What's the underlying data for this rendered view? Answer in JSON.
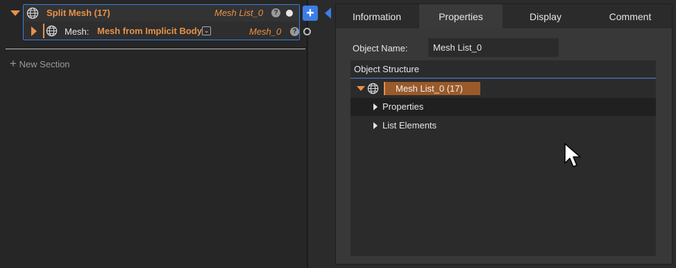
{
  "node": {
    "title": "Split Mesh (17)",
    "output_name": "Mesh List_0",
    "help": "?",
    "input_label": "Mesh:",
    "input_value": "Mesh from Implicit Body",
    "input_output_name": "Mesh_0",
    "dropdown_glyph": "⌄"
  },
  "sections": {
    "new_section_label": "New Section",
    "plus": "+"
  },
  "add_button": "+",
  "tabs": [
    "Information",
    "Properties",
    "Display",
    "Comment"
  ],
  "active_tab": "Properties",
  "object_name": {
    "label": "Object Name:",
    "value": "Mesh List_0"
  },
  "structure": {
    "header": "Object Structure",
    "root": "Mesh List_0 (17)",
    "children": [
      "Properties",
      "List Elements"
    ]
  },
  "colors": {
    "accent": "#3b7ee6",
    "orange": "#e8914a",
    "selection": "#9a5a2a"
  },
  "icons": [
    "mesh-globe-icon",
    "help-icon",
    "add-icon",
    "cursor-icon"
  ]
}
